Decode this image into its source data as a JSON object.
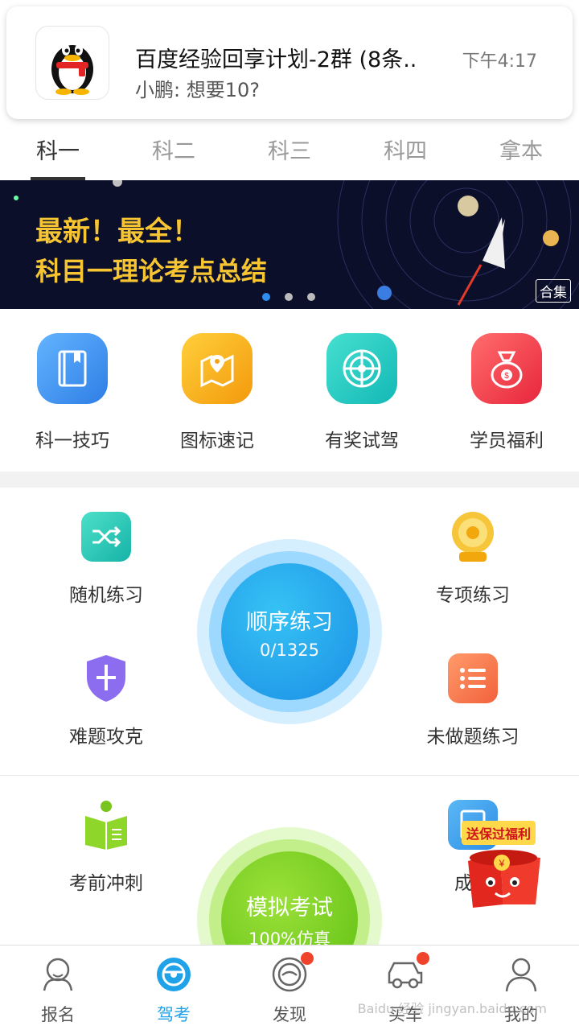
{
  "notification": {
    "title": "百度经验回享计划-2群 (8条..",
    "body": "小鹏: 想要10?",
    "time": "下午4:17",
    "app_icon": "qq-penguin-icon"
  },
  "tabs": [
    {
      "label": "科一",
      "active": true
    },
    {
      "label": "科二",
      "active": false
    },
    {
      "label": "科三",
      "active": false
    },
    {
      "label": "科四",
      "active": false
    },
    {
      "label": "拿本",
      "active": false
    }
  ],
  "banner": {
    "line1": "最新！最全！",
    "line2": "科目一理论考点总结",
    "tag": "合集",
    "slide_count": 3,
    "active_slide": 0
  },
  "quick_links": [
    {
      "label": "科一技巧",
      "icon": "book-icon",
      "color": "#3d95ef"
    },
    {
      "label": "图标速记",
      "icon": "map-pin-icon",
      "color": "#f5a315"
    },
    {
      "label": "有奖试驾",
      "icon": "steering-wheel-icon",
      "color": "#1bc8c0"
    },
    {
      "label": "学员福利",
      "icon": "money-bag-icon",
      "color": "#f2404e"
    }
  ],
  "practice": {
    "random": "随机练习",
    "special": "专项练习",
    "difficult": "难题攻克",
    "undone": "未做题练习",
    "sequential": {
      "title": "顺序练习",
      "progress": "0/1325"
    }
  },
  "exam": {
    "sprint": "考前冲刺",
    "score": "成绩",
    "mock": {
      "title": "模拟考试",
      "subtitle": "100%仿真"
    },
    "promo_tag": "送保过福利"
  },
  "bottom_nav": [
    {
      "label": "报名",
      "icon": "signup-icon",
      "active": false,
      "badge": false
    },
    {
      "label": "驾考",
      "icon": "steering-wheel-icon",
      "active": true,
      "badge": false
    },
    {
      "label": "发现",
      "icon": "discover-icon",
      "active": false,
      "badge": true
    },
    {
      "label": "买车",
      "icon": "car-icon",
      "active": false,
      "badge": true
    },
    {
      "label": "我的",
      "icon": "profile-icon",
      "active": false,
      "badge": false
    }
  ],
  "watermark": "Baidu 经验 jingyan.baidu.com",
  "colors": {
    "accent": "#1fa2e8",
    "banner_text": "#f6c531",
    "badge": "#f0432c"
  }
}
